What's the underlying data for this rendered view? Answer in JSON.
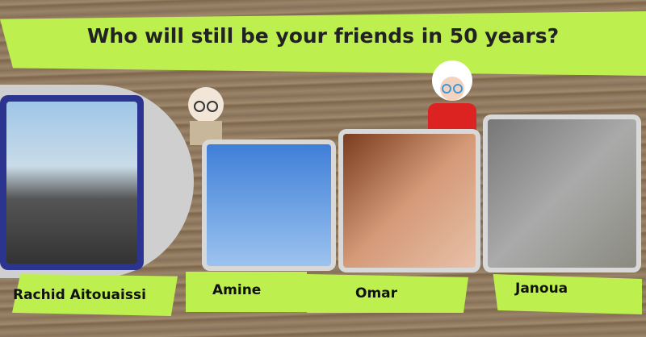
{
  "title": "Who will still be your friends in 50 years?",
  "friends": [
    {
      "name": "Rachid Aitouaissi"
    },
    {
      "name": "Amine"
    },
    {
      "name": "Omar"
    },
    {
      "name": "Janoua"
    }
  ],
  "colors": {
    "accent": "#bdf04f",
    "frame": "#d8d8d8",
    "frame_primary": "#2b3590"
  }
}
